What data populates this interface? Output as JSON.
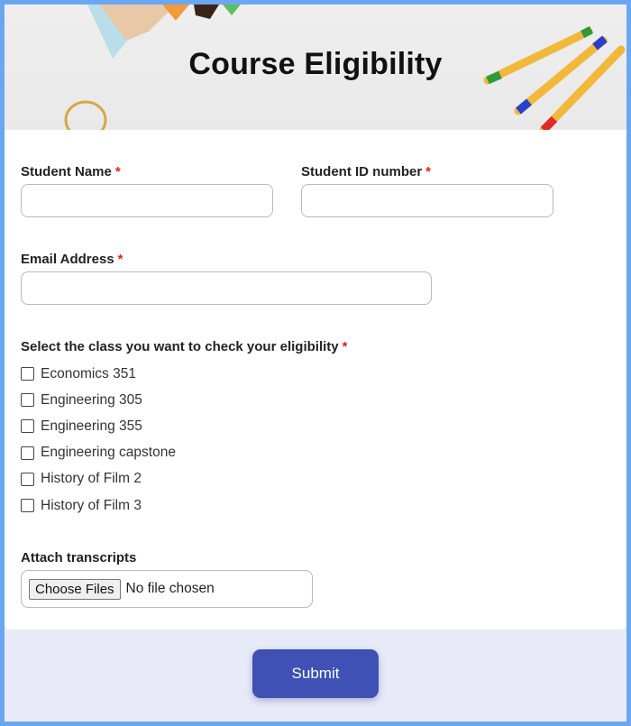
{
  "header": {
    "title": "Course Eligibility"
  },
  "form": {
    "student_name": {
      "label": "Student Name",
      "required_mark": "*",
      "value": ""
    },
    "student_id": {
      "label": "Student ID number",
      "required_mark": "*",
      "value": ""
    },
    "email": {
      "label": "Email Address",
      "required_mark": "*",
      "value": ""
    },
    "classes": {
      "label": "Select the class you want to check your eligibility",
      "required_mark": "*",
      "options": [
        {
          "label": "Economics 351",
          "checked": false
        },
        {
          "label": "Engineering 305",
          "checked": false
        },
        {
          "label": "Engineering 355",
          "checked": false
        },
        {
          "label": "Engineering capstone",
          "checked": false
        },
        {
          "label": "History of Film 2",
          "checked": false
        },
        {
          "label": "History of Film 3",
          "checked": false
        }
      ]
    },
    "attachments": {
      "label": "Attach transcripts",
      "button_label": "Choose Files",
      "status_text": "No file chosen"
    },
    "submit_label": "Submit"
  },
  "colors": {
    "page_border": "#6aa7f0",
    "accent": "#3f51b5",
    "required": "#e02020",
    "background": "#e8ebf7"
  }
}
